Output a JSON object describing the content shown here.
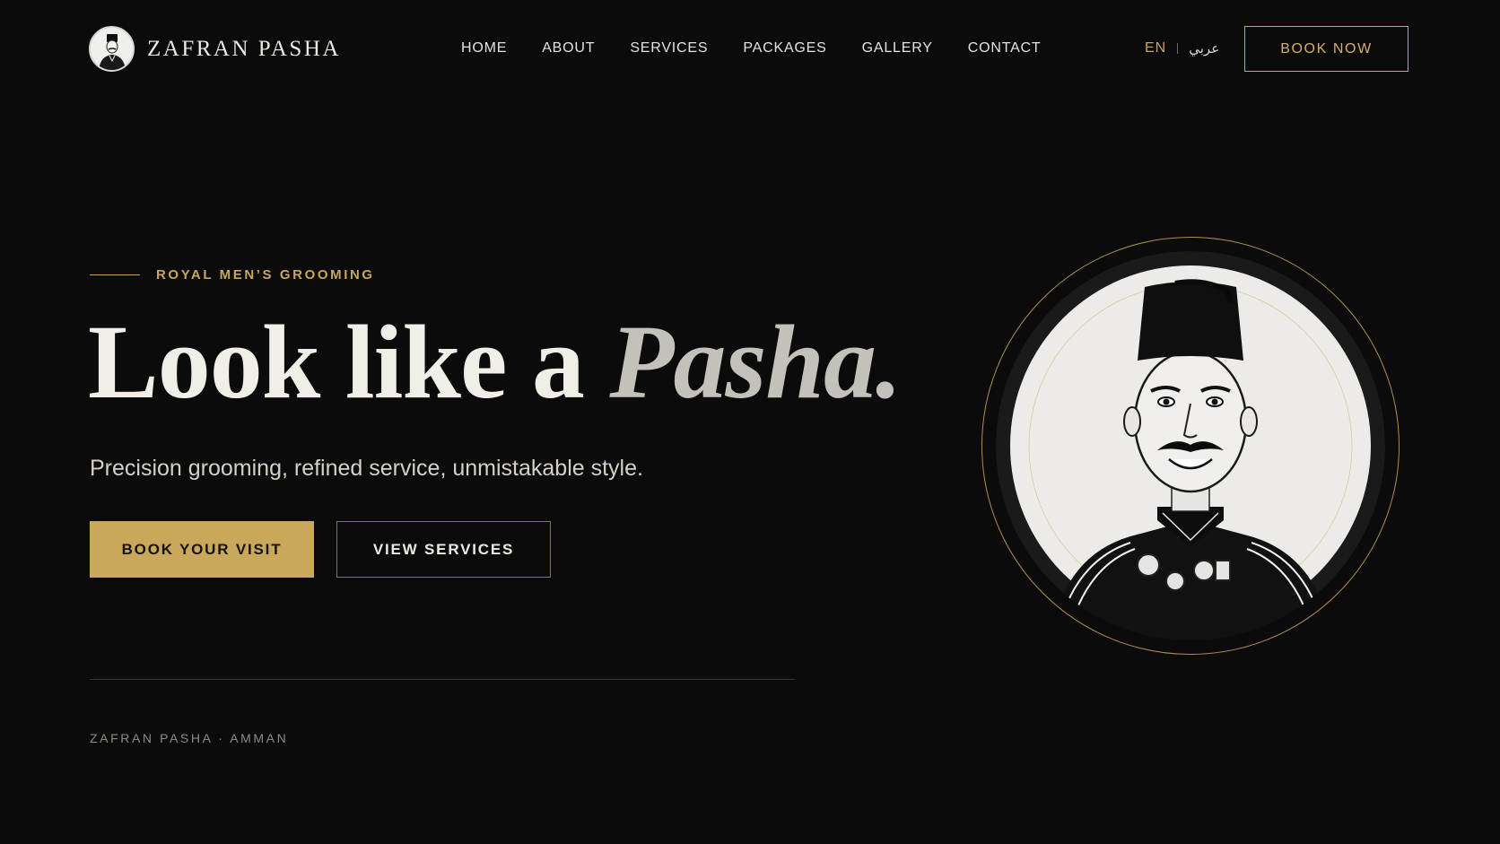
{
  "header": {
    "brand_name": "ZAFRAN PASHA",
    "nav": [
      "HOME",
      "ABOUT",
      "SERVICES",
      "PACKAGES",
      "GALLERY",
      "CONTACT"
    ],
    "lang_en": "EN",
    "lang_ar": "عربي",
    "book_now": "BOOK NOW"
  },
  "hero": {
    "eyebrow": "ROYAL MEN’S GROOMING",
    "headline_main": "Look like a ",
    "headline_accent": "Pasha.",
    "subheadline": "Precision grooming, refined service, unmistakable style.",
    "primary_cta": "BOOK YOUR VISIT",
    "secondary_cta": "VIEW SERVICES",
    "footer_note": "ZAFRAN PASHA · AMMAN"
  },
  "colors": {
    "background": "#0b0b0c",
    "gold": "#c9a65a",
    "text": "#ece9e2"
  },
  "icons": {
    "logo": "pasha-portrait-logo",
    "hero_image": "pasha-portrait-illustration"
  }
}
